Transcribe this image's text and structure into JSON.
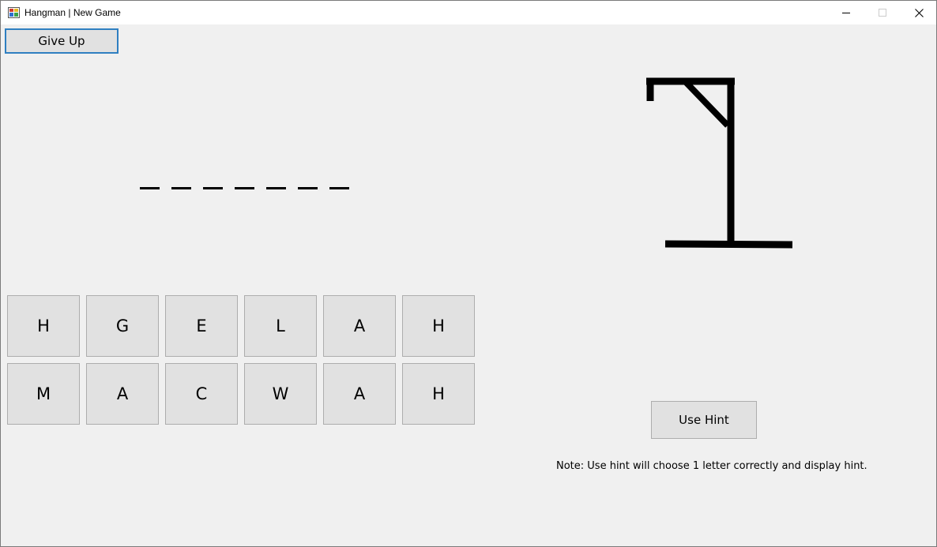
{
  "window": {
    "title": "Hangman | New Game",
    "icon": "app-window-icon",
    "controls": [
      "minimize-icon",
      "maximize-icon",
      "close-icon"
    ]
  },
  "toolbar": {
    "give_up_label": "Give Up"
  },
  "word": {
    "slots": [
      "",
      "",
      "",
      "",
      "",
      "",
      ""
    ]
  },
  "letters": {
    "row1": [
      "H",
      "G",
      "E",
      "L",
      "A",
      "H"
    ],
    "row2": [
      "M",
      "A",
      "C",
      "W",
      "A",
      "H"
    ]
  },
  "hint": {
    "button_label": "Use Hint",
    "note": "Note:  Use hint will choose 1 letter correctly and display hint."
  },
  "colors": {
    "client_bg": "#f0f0f0",
    "button_bg": "#e1e1e1",
    "focus_border": "#2f7fc1",
    "gallows": "#000000"
  }
}
